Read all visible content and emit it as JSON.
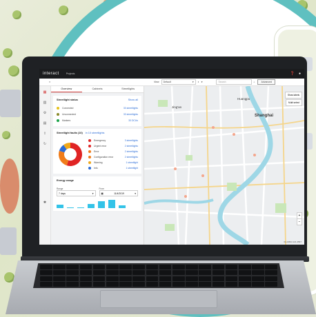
{
  "app": {
    "brand": "interact",
    "section": "Projects",
    "help_icon": "help-icon",
    "user_icon": "user-icon"
  },
  "toolbar": {
    "view_label": "View",
    "view_value": "Default",
    "search_placeholder": "Search",
    "advanced_label": "Advanced"
  },
  "panel": {
    "tabs": [
      {
        "label": "Overview",
        "active": true
      },
      {
        "label": "Cabinets",
        "active": false
      },
      {
        "label": "Streetlights",
        "active": false
      }
    ],
    "status": {
      "title": "Streetlight status",
      "link": "Show all",
      "rows": [
        {
          "label": "Connected",
          "value": "33 streetlights",
          "color": "#e6c21a"
        },
        {
          "label": "Unconnected",
          "value": "33 streetlights",
          "color": "#8a8a2a"
        },
        {
          "label": "Markers",
          "value": "33 DCUs",
          "color": "#1aa34a"
        }
      ]
    },
    "faults": {
      "title": "Streetlight faults (10)",
      "link": "in 10 streetlights",
      "rows": [
        {
          "label": "Emergency",
          "value": "3 streetlights",
          "color": "#e02424"
        },
        {
          "label": "Urgent error",
          "value": "2 streetlights",
          "color": "#e02424"
        },
        {
          "label": "Error",
          "value": "2 streetlights",
          "color": "#f07c1a"
        },
        {
          "label": "Configuration error",
          "value": "2 streetlights",
          "color": "#f07c1a"
        },
        {
          "label": "Warning",
          "value": "1 streetlight",
          "color": "#f0a81a"
        },
        {
          "label": "Info",
          "value": "1 streetlight",
          "color": "#2a6bd6"
        }
      ]
    },
    "energy": {
      "title": "Energy usage",
      "range_label": "Range",
      "range_value": "7 days",
      "from_label": "From",
      "from_value": "11/4/2019",
      "bar_levels": [
        0.35,
        0.1,
        0.1,
        0.4,
        0.7,
        0.85,
        0.3
      ]
    }
  },
  "map": {
    "labels": {
      "jingan": "Jing'an",
      "huangpu": "Huangpu",
      "shanghai": "Shanghai"
    },
    "show_labels": "Show labels",
    "multi_select": "Multi select",
    "zoom_in": "+",
    "zoom_out": "−",
    "coords": "31.22664 121.4567"
  }
}
